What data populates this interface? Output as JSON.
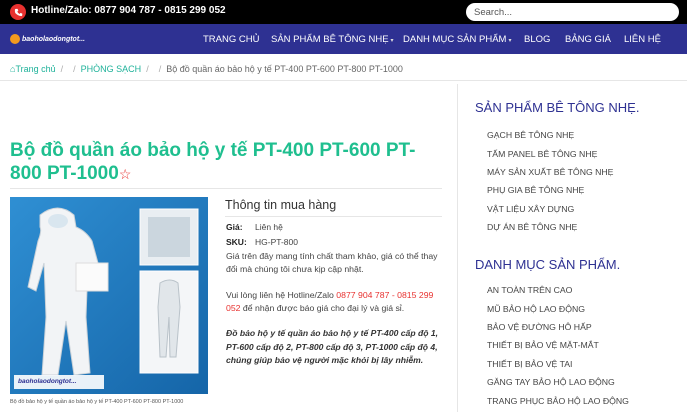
{
  "topbar": {
    "hotline": "Hotline/Zalo: 0877 904 787 - 0815 299 052",
    "search_placeholder": "Search..."
  },
  "nav": {
    "logo_text": "baoholaodongtot...",
    "items": [
      {
        "label": "TRANG CHỦ",
        "caret": ""
      },
      {
        "label": "SẢN PHẨM BÊ TÔNG NHẸ",
        "caret": "▾"
      },
      {
        "label": "DANH MỤC SẢN PHẨM",
        "caret": "▾"
      },
      {
        "label": "BLOG",
        "caret": ""
      },
      {
        "label": "BẢNG GIÁ",
        "caret": ""
      },
      {
        "label": "LIÊN HỆ",
        "caret": ""
      }
    ]
  },
  "breadcrumb": {
    "home": "Trang chủ",
    "sep": "/",
    "category": "PHÒNG SẠCH",
    "current": "Bộ đồ quần áo bảo hộ y tế PT-400 PT-600 PT-800 PT-1000"
  },
  "product": {
    "title": "Bộ đồ quần áo bảo hộ y tế PT-400 PT-600 PT-800 PT-1000",
    "star": "☆",
    "image_caption": "Bộ đồ bảo hộ y tế quần áo bảo hộ y tế PT-400 PT-600 PT-800 PT-1000",
    "image_watermark": "baoholaodongtot...",
    "buy_title": "Thông tin mua hàng",
    "price_label": "Giá:",
    "price_value": "Liên hệ",
    "sku_label": "SKU:",
    "sku_value": "HG-PT-800",
    "note": "Giá trên đây mang tính chất tham khảo, giá có thể thay đổi mà chúng tôi chưa kịp cập nhật.",
    "contact_prefix": "Vui lòng liên hệ Hotline/Zalo ",
    "contact_phone": "0877 904 787 - 0815 299 052",
    "contact_suffix": " để nhận được báo giá cho đại lý và giá sỉ.",
    "description": "Đồ bảo hộ y tế quần áo bảo hộ y tế PT-400 cấp độ 1, PT-600 cấp độ 2, PT-800 cấp độ 3, PT-1000 cấp độ 4, chúng giúp bảo vệ người mặc khỏi bị lây nhiễm."
  },
  "sidebar": {
    "section1_title": "SẢN PHẨM BÊ TÔNG NHẸ.",
    "section1_items": [
      "GẠCH BÊ TÔNG NHẸ",
      "TẤM PANEL BÊ TÔNG NHẸ",
      "MÁY SẢN XUẤT BÊ TÔNG NHẸ",
      "PHỤ GIA BÊ TÔNG NHẸ",
      "VẬT LIỆU XÂY DỰNG",
      "DỰ ÁN BÊ TÔNG NHẸ"
    ],
    "section2_title": "DANH MỤC SẢN PHẨM.",
    "section2_items": [
      "AN TOÀN TRÊN CAO",
      "MŨ BẢO HỘ LAO ĐỘNG",
      "BẢO VỆ ĐƯỜNG HÔ HẤP",
      "THIẾT BỊ BẢO VỆ MẶT-MẮT",
      "THIẾT BỊ BẢO VỆ TAI",
      "GĂNG TAY BẢO HỘ LAO ĐỘNG",
      "TRANG PHỤC BẢO HỘ LAO ĐỘNG"
    ]
  },
  "colors": {
    "nav_bg": "#2e3192",
    "title_green": "#1fbf8f",
    "accent_red": "#e8312f"
  }
}
